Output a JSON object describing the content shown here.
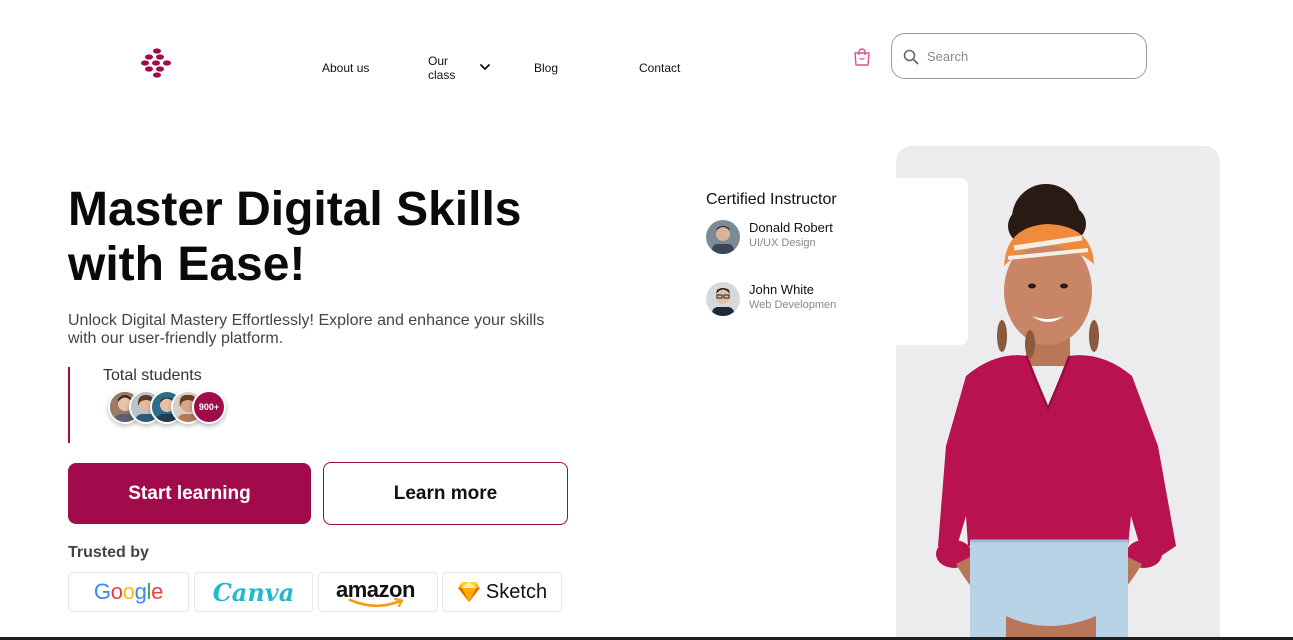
{
  "nav": {
    "logo_icon": "dots-logo-icon",
    "links": [
      {
        "label": "About us"
      },
      {
        "label": "Our class",
        "has_dropdown": true
      },
      {
        "label": "Blog"
      },
      {
        "label": "Contact"
      }
    ],
    "cart_icon": "shopping-bag-icon",
    "search": {
      "placeholder": "Search",
      "value": ""
    }
  },
  "hero": {
    "title": "Master Digital Skills with Ease!",
    "subtitle": "Unlock Digital Mastery Effortlessly! Explore and enhance your skills with our user-friendly platform.",
    "students": {
      "label": "Total students",
      "count_badge": "900+"
    },
    "primary_button": "Start learning",
    "secondary_button": "Learn more",
    "trusted_label": "Trusted by",
    "brands": [
      "Google",
      "Canva",
      "amazon",
      "Sketch"
    ]
  },
  "instructors": {
    "title": "Certified Instructor",
    "list": [
      {
        "name": "Donald Robert",
        "role": "UI/UX Design"
      },
      {
        "name": "John White",
        "role": "Web Developmen"
      }
    ]
  },
  "colors": {
    "brand": "#a10b4b",
    "text": "#111111",
    "muted": "#888888",
    "panel": "#ececee"
  }
}
